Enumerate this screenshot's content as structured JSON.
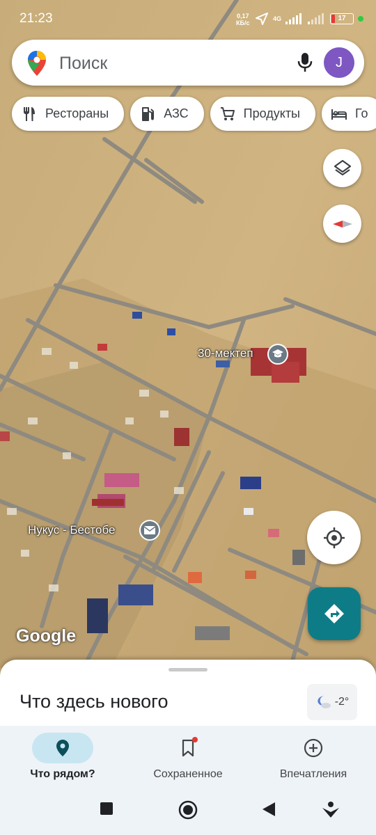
{
  "status_bar": {
    "time": "21:23",
    "net_speed_value": "0,17",
    "net_speed_unit": "КБ/с",
    "network_type": "4G",
    "battery": "17",
    "battery_level": 0.17
  },
  "search": {
    "placeholder": "Поиск",
    "avatar_letter": "J"
  },
  "chips": [
    {
      "label": "Рестораны",
      "icon": "restaurant-icon"
    },
    {
      "label": "АЗС",
      "icon": "gas-station-icon"
    },
    {
      "label": "Продукты",
      "icon": "cart-icon"
    },
    {
      "label": "Го",
      "icon": "hotel-icon"
    }
  ],
  "map": {
    "labels": {
      "school": "30-мектеп",
      "post_office": "Нукус - Бестобе"
    },
    "attribution": "Google"
  },
  "sheet": {
    "title": "Что здесь нового",
    "weather_temp": "-2°",
    "weather_icon": "moon-cloud-icon"
  },
  "bottom_nav": [
    {
      "label": "Что рядом?",
      "icon": "location-pin-icon",
      "active": true
    },
    {
      "label": "Сохраненное",
      "icon": "bookmark-icon",
      "active": false
    },
    {
      "label": "Впечатления",
      "icon": "add-circle-icon",
      "active": false
    }
  ],
  "colors": {
    "accent_teal": "#0e7c86",
    "active_pill": "#c7e6f1",
    "avatar": "#7e57c2"
  }
}
